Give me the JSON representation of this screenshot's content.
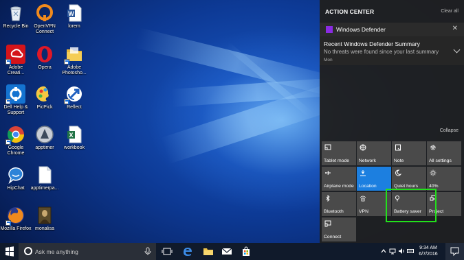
{
  "desktop": {
    "icons": [
      {
        "label": "Recycle Bin",
        "icon": "recycle-bin-icon"
      },
      {
        "label": "OpenVPN Connect",
        "icon": "openvpn-icon"
      },
      {
        "label": "lorem",
        "icon": "word-document-icon"
      },
      {
        "label": "Adobe Creati...",
        "icon": "adobe-creative-cloud-icon"
      },
      {
        "label": "Opera",
        "icon": "opera-icon"
      },
      {
        "label": "Adobe Photosho...",
        "icon": "folder-icon"
      },
      {
        "label": "Dell Help & Support",
        "icon": "dell-help-icon"
      },
      {
        "label": "PicPick",
        "icon": "picpick-icon"
      },
      {
        "label": "Reflect",
        "icon": "reflect-icon"
      },
      {
        "label": "Google Chrome",
        "icon": "chrome-icon"
      },
      {
        "label": "apptimer",
        "icon": "apptimer-icon"
      },
      {
        "label": "workbook",
        "icon": "excel-workbook-icon"
      },
      {
        "label": "HipChat",
        "icon": "hipchat-icon"
      },
      {
        "label": "apptimerpa...",
        "icon": "blank-document-icon"
      },
      {
        "label": "Mozilla Firefox",
        "icon": "firefox-icon"
      },
      {
        "label": "monalisa",
        "icon": "image-file-icon"
      }
    ]
  },
  "action_center": {
    "title": "ACTION CENTER",
    "clear_all": "Clear all",
    "notification": {
      "app_name": "Windows Defender",
      "title": "Recent Windows Defender Summary",
      "text": "No threats were found since your last summary",
      "time": "Mon"
    },
    "collapse": "Collapse",
    "tiles": [
      {
        "label": "Tablet mode",
        "icon": "tablet-mode-icon",
        "active": false
      },
      {
        "label": "Network",
        "icon": "network-icon",
        "active": false
      },
      {
        "label": "Note",
        "icon": "note-icon",
        "active": false
      },
      {
        "label": "All settings",
        "icon": "settings-gear-icon",
        "active": false
      },
      {
        "label": "Airplane mode",
        "icon": "airplane-icon",
        "active": false
      },
      {
        "label": "Location",
        "icon": "location-icon",
        "active": true
      },
      {
        "label": "Quiet hours",
        "icon": "moon-icon",
        "active": false
      },
      {
        "label": "40%",
        "icon": "brightness-icon",
        "active": false
      },
      {
        "label": "Bluetooth",
        "icon": "bluetooth-icon",
        "active": false
      },
      {
        "label": "VPN",
        "icon": "vpn-icon",
        "active": false
      },
      {
        "label": "Battery saver",
        "icon": "battery-saver-icon",
        "active": false
      },
      {
        "label": "Project",
        "icon": "project-icon",
        "active": false
      },
      {
        "label": "Connect",
        "icon": "connect-icon",
        "active": false
      }
    ]
  },
  "taskbar": {
    "search_placeholder": "Ask me anything",
    "clock_time": "9:34 AM",
    "clock_date": "6/7/2016"
  },
  "colors": {
    "highlight": "#22e01b",
    "active_tile": "#1c7fe0"
  }
}
